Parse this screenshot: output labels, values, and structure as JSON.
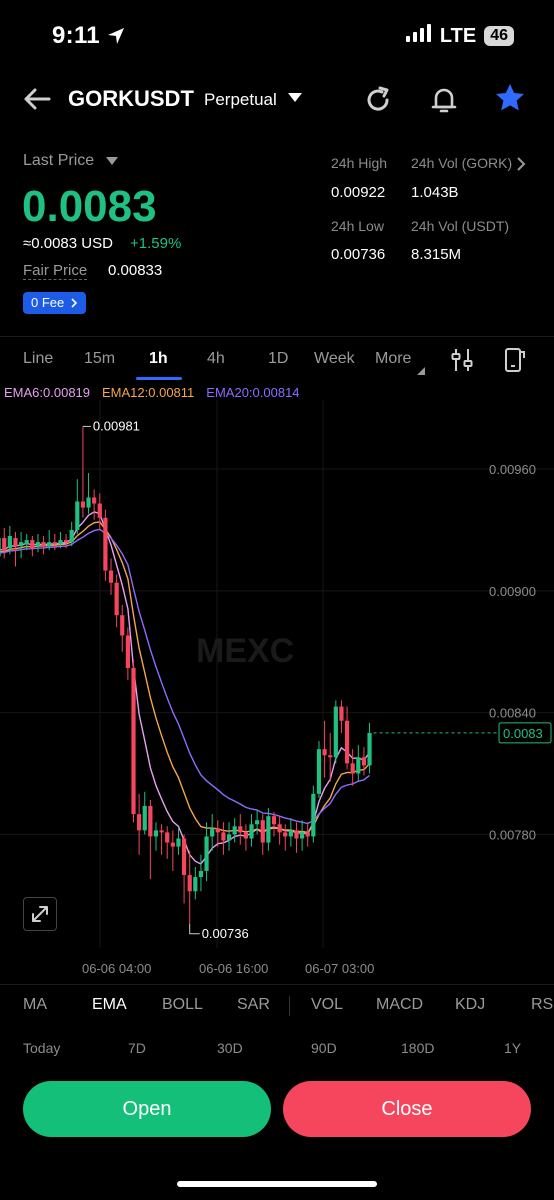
{
  "status_bar": {
    "time": "9:11",
    "network": "LTE",
    "battery": "46"
  },
  "header": {
    "symbol": "GORKUSDT",
    "contract_type": "Perpetual"
  },
  "ticker": {
    "last_price_label": "Last Price",
    "last_price": "0.0083",
    "approx": "≈0.0083",
    "currency": "USD",
    "change_pct": "+1.59%",
    "fair_price_label": "Fair Price",
    "fair_price": "0.00833",
    "fee_badge": "0 Fee",
    "high_label": "24h High",
    "high": "0.00922",
    "vol_base_label": "24h Vol (GORK)",
    "vol_base": "1.043B",
    "low_label": "24h Low",
    "low": "0.00736",
    "vol_quote_label": "24h Vol  (USDT)",
    "vol_quote": "8.315M"
  },
  "timeframes": [
    "Line",
    "15m",
    "1h",
    "4h",
    "1D",
    "Week",
    "More"
  ],
  "active_timeframe": "1h",
  "ema_legend": {
    "ema6": "EMA6:0.00819",
    "ema12": "EMA12:0.00811",
    "ema20": "EMA20:0.00814"
  },
  "colors": {
    "up": "#1fc081",
    "down": "#f6465d",
    "ema6": "#e6a0f0",
    "ema12": "#f5a54a",
    "ema20": "#8f6bff",
    "accent": "#2f6bff"
  },
  "chart_data": {
    "type": "candlestick",
    "y_ticks": [
      "0.00960",
      "0.00900",
      "0.00840",
      "0.00780"
    ],
    "ylim": [
      0.00728,
      0.00994
    ],
    "x_ticks": [
      "06-06 04:00",
      "06-06 16:00",
      "06-07 03:00"
    ],
    "current_price_tag": "0.0083",
    "high_marker": "0.00981",
    "low_marker": "0.00736",
    "watermark": "MEXC",
    "candles": [
      [
        0.00929,
        0.00918,
        0.00932,
        0.00914
      ],
      [
        0.00917,
        0.00926,
        0.0093,
        0.00913
      ],
      [
        0.00926,
        0.0092,
        0.00931,
        0.00916
      ],
      [
        0.00921,
        0.00927,
        0.00932,
        0.00918
      ],
      [
        0.00926,
        0.00922,
        0.00929,
        0.00912
      ],
      [
        0.00922,
        0.00924,
        0.00929,
        0.00916
      ],
      [
        0.00923,
        0.00925,
        0.00928,
        0.0092
      ],
      [
        0.00925,
        0.00921,
        0.00927,
        0.00917
      ],
      [
        0.00922,
        0.00924,
        0.00928,
        0.00919
      ],
      [
        0.00924,
        0.00922,
        0.00927,
        0.00918
      ],
      [
        0.00922,
        0.00924,
        0.0093,
        0.0092
      ],
      [
        0.00924,
        0.00923,
        0.00928,
        0.0092
      ],
      [
        0.00923,
        0.00925,
        0.00929,
        0.00921
      ],
      [
        0.00925,
        0.00924,
        0.00928,
        0.00921
      ],
      [
        0.00924,
        0.0093,
        0.00934,
        0.00922
      ],
      [
        0.0093,
        0.00944,
        0.00955,
        0.00928
      ],
      [
        0.00944,
        0.00941,
        0.00981,
        0.00936
      ],
      [
        0.00941,
        0.00946,
        0.00958,
        0.00938
      ],
      [
        0.00946,
        0.00943,
        0.0095,
        0.00935
      ],
      [
        0.00943,
        0.00936,
        0.00948,
        0.0093
      ],
      [
        0.00936,
        0.0091,
        0.0094,
        0.00905
      ],
      [
        0.0091,
        0.00904,
        0.00916,
        0.00898
      ],
      [
        0.00904,
        0.00888,
        0.00908,
        0.00882
      ],
      [
        0.00888,
        0.00878,
        0.00893,
        0.0087
      ],
      [
        0.00878,
        0.00862,
        0.00882,
        0.00856
      ],
      [
        0.00862,
        0.0079,
        0.00866,
        0.00786
      ],
      [
        0.0079,
        0.00782,
        0.008,
        0.0077
      ],
      [
        0.00782,
        0.00794,
        0.00801,
        0.0078
      ],
      [
        0.00794,
        0.00779,
        0.00797,
        0.00758
      ],
      [
        0.00779,
        0.00782,
        0.00786,
        0.00772
      ],
      [
        0.00782,
        0.00781,
        0.00785,
        0.0077
      ],
      [
        0.00781,
        0.00776,
        0.00784,
        0.00768
      ],
      [
        0.00776,
        0.00774,
        0.00782,
        0.00762
      ],
      [
        0.00774,
        0.00778,
        0.00783,
        0.0077
      ],
      [
        0.00778,
        0.0076,
        0.0078,
        0.00746
      ],
      [
        0.0076,
        0.00752,
        0.00772,
        0.00736
      ],
      [
        0.00752,
        0.00759,
        0.00764,
        0.00748
      ],
      [
        0.00759,
        0.00762,
        0.0077,
        0.00752
      ],
      [
        0.00762,
        0.00779,
        0.00786,
        0.00757
      ],
      [
        0.00779,
        0.00783,
        0.0079,
        0.00772
      ],
      [
        0.00783,
        0.00781,
        0.00787,
        0.00774
      ],
      [
        0.00781,
        0.00777,
        0.00786,
        0.0077
      ],
      [
        0.00777,
        0.0078,
        0.00786,
        0.00772
      ],
      [
        0.0078,
        0.00784,
        0.00788,
        0.00776
      ],
      [
        0.00784,
        0.00781,
        0.0079,
        0.00775
      ],
      [
        0.00781,
        0.00778,
        0.00785,
        0.00772
      ],
      [
        0.00778,
        0.00785,
        0.0079,
        0.00774
      ],
      [
        0.00785,
        0.00787,
        0.00792,
        0.0078
      ],
      [
        0.00787,
        0.00776,
        0.0079,
        0.0077
      ],
      [
        0.00776,
        0.00789,
        0.00793,
        0.00772
      ],
      [
        0.00789,
        0.00785,
        0.00791,
        0.00779
      ],
      [
        0.00785,
        0.00781,
        0.00789,
        0.00775
      ],
      [
        0.00781,
        0.00779,
        0.00785,
        0.00772
      ],
      [
        0.00779,
        0.00782,
        0.00788,
        0.00774
      ],
      [
        0.00782,
        0.00778,
        0.00786,
        0.00771
      ],
      [
        0.00778,
        0.00781,
        0.00787,
        0.00772
      ],
      [
        0.00781,
        0.00779,
        0.00786,
        0.00774
      ],
      [
        0.00779,
        0.008,
        0.00804,
        0.00776
      ],
      [
        0.008,
        0.00822,
        0.00826,
        0.00798
      ],
      [
        0.00822,
        0.00819,
        0.00836,
        0.00808
      ],
      [
        0.00819,
        0.00818,
        0.0083,
        0.00806
      ],
      [
        0.00818,
        0.00843,
        0.00846,
        0.00815
      ],
      [
        0.00843,
        0.00836,
        0.00846,
        0.0083
      ],
      [
        0.00836,
        0.00815,
        0.00843,
        0.00812
      ],
      [
        0.00815,
        0.0081,
        0.00822,
        0.00804
      ],
      [
        0.0081,
        0.00818,
        0.00824,
        0.00806
      ],
      [
        0.00818,
        0.00814,
        0.00823,
        0.00809
      ],
      [
        0.00814,
        0.0083,
        0.00835,
        0.0081
      ]
    ]
  },
  "indicators": [
    "MA",
    "EMA",
    "BOLL",
    "SAR",
    "VOL",
    "MACD",
    "KDJ",
    "RSI"
  ],
  "active_indicator": "EMA",
  "ranges": [
    "Today",
    "7D",
    "30D",
    "90D",
    "180D",
    "1Y"
  ],
  "actions": {
    "open": "Open",
    "close": "Close"
  }
}
